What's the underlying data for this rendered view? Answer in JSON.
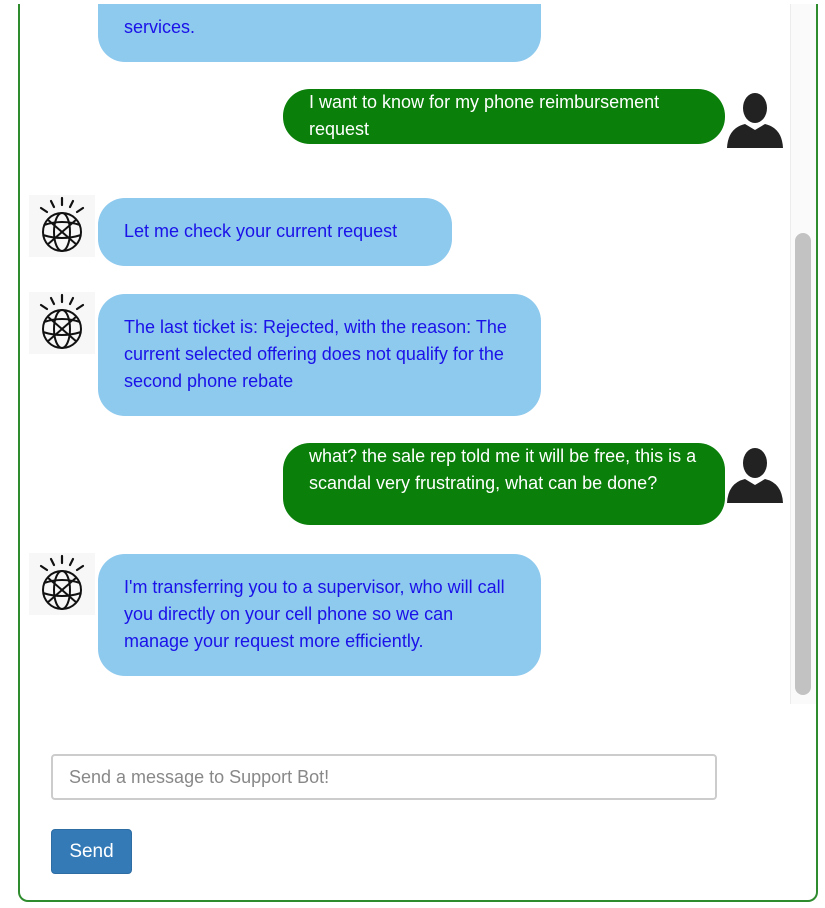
{
  "chat": {
    "messages": [
      {
        "sender": "bot",
        "text": "services."
      },
      {
        "sender": "user",
        "text": "I want to know for my phone reimbursement request"
      },
      {
        "sender": "bot",
        "text": "Let me check your current request"
      },
      {
        "sender": "bot",
        "text": "The last ticket is: Rejected, with the reason: The current selected offering does not qualify for the second phone rebate"
      },
      {
        "sender": "user",
        "text": "what? the sale rep told me it will be free, this is a scandal very frustrating, what can be done?"
      },
      {
        "sender": "bot",
        "text": "I'm transferring you to a supervisor, who will call you directly on your cell phone so we can manage your request more efficiently."
      }
    ]
  },
  "composer": {
    "placeholder": "Send a message to Support Bot!",
    "send_label": "Send"
  },
  "icons": {
    "bot_avatar": "globe-avatar-icon",
    "user_avatar": "user-silhouette-icon"
  },
  "colors": {
    "bot_bubble": "#8ec9ee",
    "bot_text": "#1a12e8",
    "user_bubble": "#0a7f0a",
    "user_text": "#ffffff",
    "frame_border": "#2e8b2e",
    "send_button": "#337ab7"
  }
}
